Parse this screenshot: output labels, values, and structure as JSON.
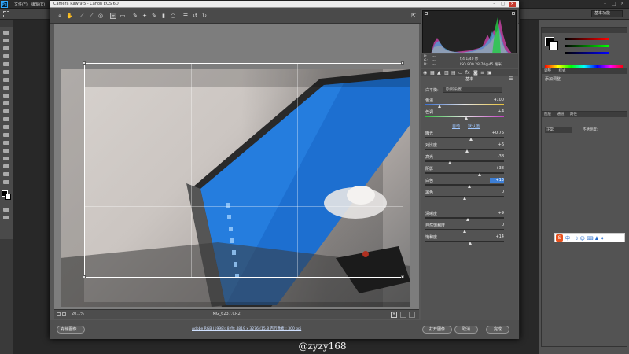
{
  "ps": {
    "menus": [
      "文件(F)",
      "编辑(E)"
    ],
    "workspace": "基本功能",
    "adjustments_title": "添加调整",
    "panel_tabs": [
      "调整",
      "样式"
    ],
    "layers_tabs": [
      "图层",
      "通道",
      "路径"
    ],
    "layers_mode": "正常",
    "layers_opacity": "不透明度:"
  },
  "cr": {
    "title": "Camera Raw 9.5  -  Canon EOS 6D",
    "preview_mode_label": "",
    "zoom": "20.1%",
    "filename": "IMG_6237.CR2",
    "workflow": "Adobe RGB (1998); 8 位; 4819 x 3276 (15.8 百万像素); 300 ppi",
    "btn_save": "存储图像...",
    "btn_open": "打开图像",
    "btn_cancel": "取消",
    "btn_done": "完成",
    "rgb": {
      "r": "R:",
      "g": "G:",
      "b": "B:",
      "rv": "---",
      "gv": "---",
      "bv": "---"
    },
    "exposure_info": "f/4   1/40 秒",
    "iso_info": "ISO 800   28-70@45 毫米",
    "panel_name": "基本",
    "wb_label": "白平衡:",
    "wb_value": "原照设置",
    "auto": "自动",
    "default": "默认值",
    "sliders": [
      {
        "label": "色温",
        "value": "4100",
        "pos": 0.18
      },
      {
        "label": "色调",
        "value": "+4",
        "pos": 0.52
      },
      {
        "label": "曝光",
        "value": "+0.75",
        "pos": 0.58
      },
      {
        "label": "对比度",
        "value": "+6",
        "pos": 0.53
      },
      {
        "label": "高光",
        "value": "-38",
        "pos": 0.31
      },
      {
        "label": "阴影",
        "value": "+38",
        "pos": 0.69
      },
      {
        "label": "白色",
        "value": "+13",
        "pos": 0.56
      },
      {
        "label": "黑色",
        "value": "0",
        "pos": 0.5
      },
      {
        "label": "清晰度",
        "value": "+9",
        "pos": 0.54
      },
      {
        "label": "自然饱和度",
        "value": "0",
        "pos": 0.5
      },
      {
        "label": "饱和度",
        "value": "+14",
        "pos": 0.57
      }
    ]
  },
  "watermark": "@zyzy168",
  "colors": {
    "accent": "#31a8ff",
    "screen_blue": "#1d6fd0",
    "chrome_dark": "#2a2a2a"
  }
}
